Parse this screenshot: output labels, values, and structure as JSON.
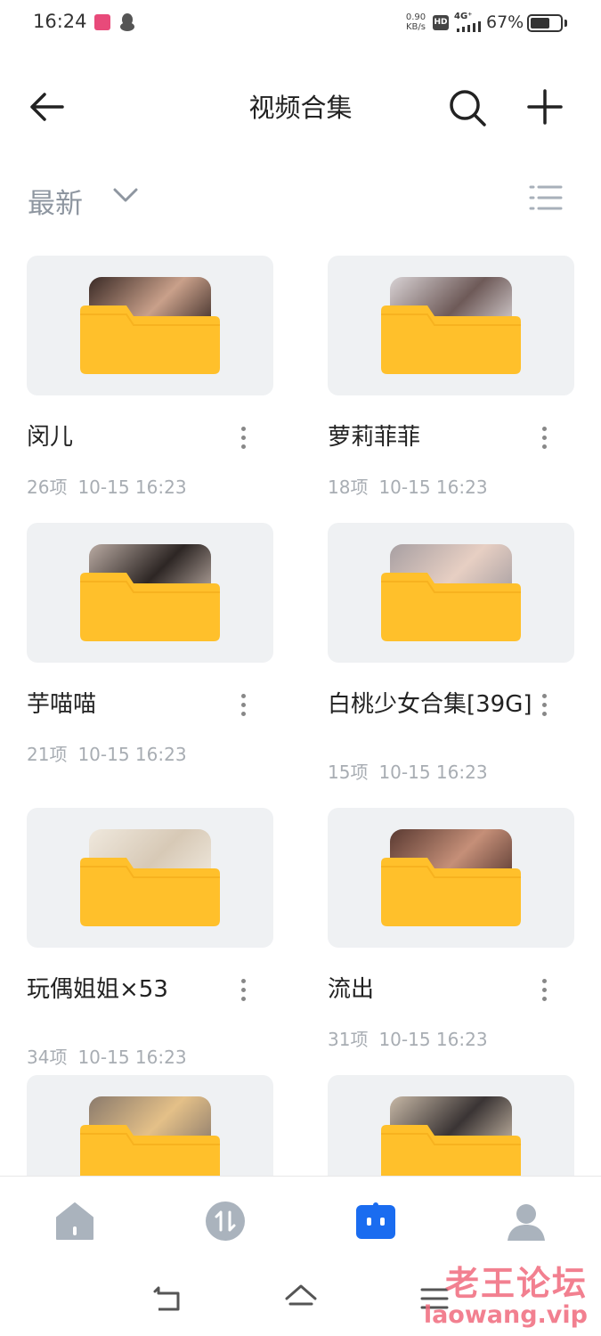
{
  "status_bar": {
    "time": "16:24",
    "net_speed_value": "0.90",
    "net_speed_unit": "KB/s",
    "hd_badge": "HD",
    "network": "4G⁺",
    "battery_percent_text": "67%",
    "battery_level": 0.67
  },
  "header": {
    "title": "视频合集",
    "back_icon": "arrow-left-icon",
    "search_icon": "search-icon",
    "add_icon": "plus-icon"
  },
  "sort": {
    "label": "最新",
    "chevron_icon": "chevron-down-icon",
    "view_icon": "list-view-icon"
  },
  "colors": {
    "folder": "#ffc02b",
    "folder_tab": "#f7b21f",
    "card_bg": "#eff1f3",
    "accent": "#1a6cf0",
    "meta_text": "#a8adb3"
  },
  "folders": [
    {
      "name": "闵儿",
      "count": "26项",
      "date": "10-15 16:23",
      "thumb": [
        "#3a2a26",
        "#c9a08a"
      ]
    },
    {
      "name": "萝莉菲菲",
      "count": "18项",
      "date": "10-15 16:23",
      "thumb": [
        "#d8d2d4",
        "#6e5a58"
      ]
    },
    {
      "name": "芋喵喵",
      "count": "21项",
      "date": "10-15 16:23",
      "thumb": [
        "#b9aaa2",
        "#2d2624"
      ]
    },
    {
      "name": "白桃少女合集[39G]",
      "count": "15项",
      "date": "10-15 16:23",
      "thumb": [
        "#a79fa2",
        "#e7cfc3"
      ]
    },
    {
      "name": "玩偶姐姐×53",
      "count": "34项",
      "date": "10-15 16:23",
      "thumb": [
        "#efe8dd",
        "#d7c9b6"
      ]
    },
    {
      "name": "流出",
      "count": "31项",
      "date": "10-15 16:23",
      "thumb": [
        "#5a3a32",
        "#c58f78"
      ]
    },
    {
      "name": "",
      "count": "",
      "date": "",
      "thumb": [
        "#8a7a6c",
        "#e4c088"
      ]
    },
    {
      "name": "",
      "count": "",
      "date": "",
      "thumb": [
        "#c7b8a6",
        "#3a3434"
      ]
    }
  ],
  "bottom_nav": [
    {
      "icon": "home-icon",
      "active": false
    },
    {
      "icon": "transfer-icon",
      "active": false
    },
    {
      "icon": "files-icon",
      "active": true
    },
    {
      "icon": "profile-icon",
      "active": false
    }
  ],
  "system_nav": {
    "back_icon": "system-back-icon",
    "home_icon": "system-home-icon",
    "menu_icon": "system-menu-icon"
  },
  "watermark": {
    "title": "老王论坛",
    "url": "laowang.vip"
  }
}
